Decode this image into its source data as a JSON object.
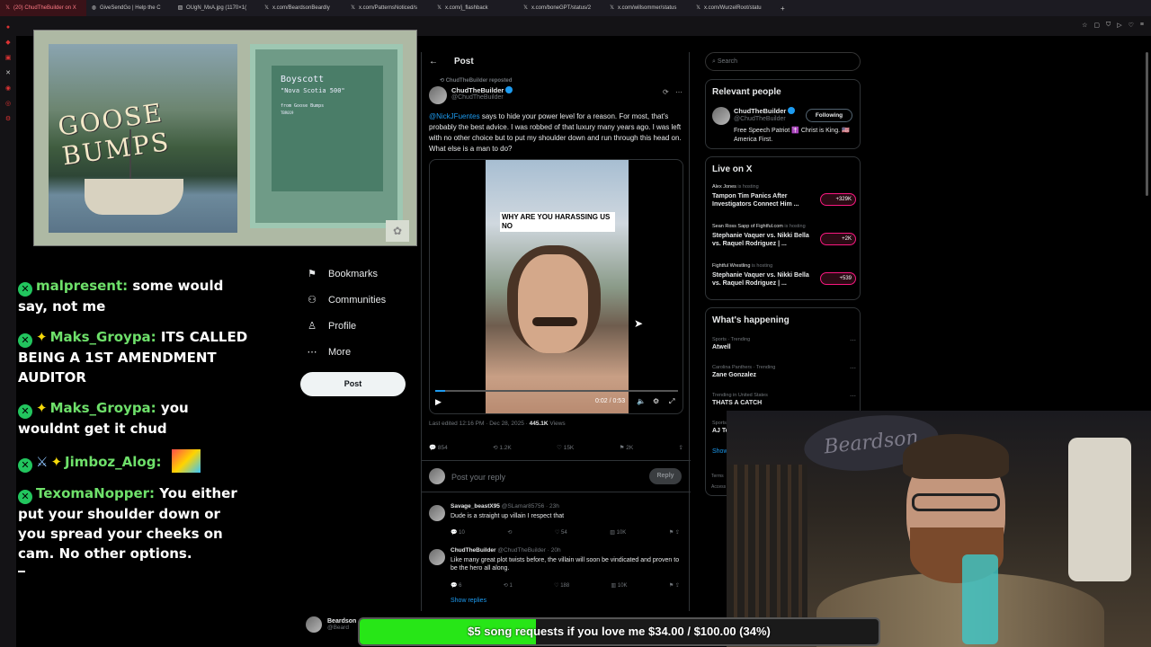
{
  "tabs": [
    {
      "label": "(20) ChudTheBuilder on X",
      "icon": "x-icon",
      "active": true
    },
    {
      "label": "GiveSendGo | Help the C",
      "icon": "globe-icon"
    },
    {
      "label": "OUgN_MxA.jpg (1170×1(",
      "icon": "image-icon"
    },
    {
      "label": "x.com/BeardsonBeardly",
      "icon": "x-icon"
    },
    {
      "label": "x.com/PatternsNoticed/s",
      "icon": "x-icon"
    },
    {
      "label": "x.com/j_flashback",
      "icon": "x-icon"
    },
    {
      "label": "x.com/boneGPT/status/2",
      "icon": "x-icon"
    },
    {
      "label": "x.com/willsommer/status",
      "icon": "x-icon"
    },
    {
      "label": "x.com/WurzelRoot/statu",
      "icon": "x-icon"
    }
  ],
  "album": {
    "cover_title": "GOOSE BUMPS",
    "artist": "Boyscott",
    "song": "\"Nova Scotia 500\"",
    "from": "from Goose Bumps",
    "code": "TBR019"
  },
  "chat": [
    {
      "user": "malpresent:",
      "text": "some would say, not me",
      "badges": [
        "check"
      ]
    },
    {
      "user": "Maks_Groypa:",
      "text": "ITS CALLED BEING A 1ST AMENDMENT AUDITOR",
      "badges": [
        "check",
        "star"
      ]
    },
    {
      "user": "Maks_Groypa:",
      "text": "you wouldnt get it chud",
      "badges": [
        "check",
        "star"
      ]
    },
    {
      "user": "Jimboz_Alog:",
      "text": "",
      "badges": [
        "check",
        "sword",
        "star"
      ],
      "emote": true
    },
    {
      "user": "TexomaNopper:",
      "text": "You either put your shoulder down or you spread your cheeks on cam. No other options.",
      "badges": [
        "check"
      ]
    }
  ],
  "nav": {
    "items": [
      {
        "label": "Bookmarks",
        "icon": "bookmark-icon"
      },
      {
        "label": "Communities",
        "icon": "communities-icon"
      },
      {
        "label": "Profile",
        "icon": "profile-icon"
      },
      {
        "label": "More",
        "icon": "more-icon"
      }
    ],
    "post_button": "Post"
  },
  "post": {
    "header": "Post",
    "reposted_by": "ChudTheBuilder reposted",
    "author_name": "ChudTheBuilder",
    "author_handle": "@ChudTheBuilder",
    "mention": "@NickJFuentes",
    "text": " says to hide your power level for a reason. For most, that's probably the best advice. I was robbed of that luxury many years ago. I was left with no other choice but to put my shoulder down and run through this head on. What else is a man to do?",
    "video_caption": "WHY ARE YOU HARASSING US NO",
    "video_time": "0:02 / 0:53",
    "progress": 0.04,
    "edited": "Last edited 12:16 PM · Dec 28, 2025 · ",
    "views_count": "445.1K",
    "views_label": " Views",
    "actions": {
      "replies": "854",
      "reposts": "1.2K",
      "likes": "15K",
      "bookmarks": "2K"
    },
    "reply_placeholder": "Post your reply",
    "reply_button": "Reply"
  },
  "replies": [
    {
      "name": "Savage_beastX95",
      "handle": "@SLamar85756 · 23h",
      "text": "Dude is a straight up villain I respect that",
      "replies": "10",
      "reposts": "",
      "likes": "54",
      "views": "10K"
    },
    {
      "name": "ChudTheBuilder",
      "handle": "@ChudTheBuilder · 20h",
      "text": "Like many great plot twists before, the villain will soon be vindicated and proven to be the hero all along.",
      "replies": "6",
      "reposts": "1",
      "likes": "188",
      "views": "10K"
    }
  ],
  "show_replies": "Show replies",
  "search": {
    "placeholder": "Search"
  },
  "relevant": {
    "title": "Relevant people",
    "name": "ChudTheBuilder",
    "handle": "@ChudTheBuilder",
    "bio": "Free Speech Patriot ✝️ Christ is King. 🇺🇸America First.",
    "follow": "Following"
  },
  "live": {
    "title": "Live on X",
    "items": [
      {
        "host": "Alex Jones",
        "status": " is hosting",
        "title": "Tampon Tim Panics After Investigators Connect Him ...",
        "count": "+329K"
      },
      {
        "host": "Sean Ross Sapp of Fightful.com",
        "status": " is hosting",
        "title": "Stephanie Vaquer vs. Nikki Bella vs. Raquel Rodriguez | ...",
        "count": "+2K"
      },
      {
        "host": "Fightful Wrestling",
        "status": " is hosting",
        "title": "Stephanie Vaquer vs. Nikki Bella vs. Raquel Rodriguez | ...",
        "count": "+539"
      }
    ]
  },
  "happening": {
    "title": "What's happening",
    "trends": [
      {
        "category": "Sports · Trending",
        "name": "Atwell"
      },
      {
        "category": "Carolina Panthers · Trending",
        "name": "Zane Gonzalez"
      },
      {
        "category": "Trending in United States",
        "name": "THATS A CATCH"
      },
      {
        "category": "Sports",
        "name": "AJ Te"
      }
    ],
    "show_more": "Show"
  },
  "footer": {
    "terms": "Terms",
    "access": "Access"
  },
  "bottom_user": {
    "name": "Beardson",
    "handle": "@Beard"
  },
  "goal": {
    "text": "$5 song requests if you love me $34.00 / $100.00 (34%)",
    "fraction": 0.34
  },
  "webcam": {
    "sign": "Beardson"
  }
}
